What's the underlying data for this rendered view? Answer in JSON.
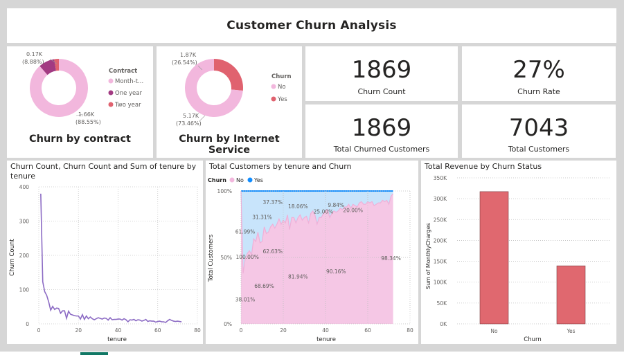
{
  "page_title": "Customer Churn Analysis",
  "contract_card": {
    "title": "Churn by contract",
    "legend_title": "Contract",
    "legend": [
      {
        "label": "Month-t...",
        "color": "#f2b7dd"
      },
      {
        "label": "One year",
        "color": "#a23a82"
      },
      {
        "label": "Two year",
        "color": "#e0626f"
      }
    ],
    "label_small": "0.17K",
    "label_small_pct": "(8.88%)",
    "label_big": "1.66K",
    "label_big_pct": "(88.55%)"
  },
  "internet_card": {
    "title": "Churn by Internet Service",
    "legend_title": "Churn",
    "legend": [
      {
        "label": "No",
        "color": "#f2b7dd"
      },
      {
        "label": "Yes",
        "color": "#e0626f"
      }
    ],
    "label_yes": "1.87K",
    "label_yes_pct": "(26.54%)",
    "label_no": "5.17K",
    "label_no_pct": "(73.46%)"
  },
  "kpis": [
    {
      "value": "1869",
      "label": "Churn Count"
    },
    {
      "value": "27%",
      "label": "Churn Rate"
    },
    {
      "value": "1869",
      "label": "Total Churned Customers"
    },
    {
      "value": "7043",
      "label": "Total Customers"
    }
  ],
  "line_chart": {
    "title_line1": "Churn Count, Churn Count and Sum of tenure by",
    "title_line2": "tenure",
    "ylabel": "Churn Count",
    "xlabel": "tenure",
    "y_ticks": [
      "400",
      "300",
      "200",
      "100",
      "0"
    ],
    "x_ticks": [
      "0",
      "20",
      "40",
      "60",
      "80"
    ]
  },
  "area_chart": {
    "title": "Total Customers by tenure and Churn",
    "legend_title": "Churn",
    "legend": [
      {
        "label": "No",
        "color": "#f2b7dd"
      },
      {
        "label": "Yes",
        "color": "#118dff"
      }
    ],
    "ylabel": "Total Customers",
    "xlabel": "tenure",
    "y_ticks": [
      "100%",
      "50%",
      "0%"
    ],
    "x_ticks": [
      "0",
      "20",
      "40",
      "60",
      "80"
    ],
    "labels": [
      "37.37%",
      "18.06%",
      "9.84%",
      "31.31%",
      "25.00%",
      "20.00%",
      "61.99%",
      "62.63%",
      "100.00%",
      "81.94%",
      "90.16%",
      "98.34%",
      "68.69%",
      "38.01%"
    ]
  },
  "bar_chart": {
    "title": "Total Revenue by Churn Status",
    "ylabel": "Sum of MonthlyCharges",
    "xlabel": "Churn",
    "y_ticks": [
      "350K",
      "300K",
      "250K",
      "200K",
      "150K",
      "100K",
      "50K",
      "0K"
    ],
    "bar_color": "#e0686f"
  },
  "chart_data": [
    {
      "type": "pie",
      "title": "Churn by contract",
      "categories": [
        "Month-to-month",
        "One year",
        "Two year"
      ],
      "values": [
        1655,
        166,
        48
      ],
      "percentages": [
        88.55,
        8.88,
        2.57
      ]
    },
    {
      "type": "pie",
      "title": "Churn by Internet Service",
      "categories": [
        "No",
        "Yes"
      ],
      "values": [
        5174,
        1869
      ],
      "percentages": [
        73.46,
        26.54
      ]
    },
    {
      "type": "line",
      "title": "Churn Count, Churn Count and Sum of tenure by tenure",
      "xlabel": "tenure",
      "ylabel": "Churn Count",
      "xlim": [
        0,
        80
      ],
      "ylim": [
        0,
        400
      ],
      "x": [
        1,
        2,
        3,
        4,
        5,
        6,
        7,
        8,
        9,
        10,
        11,
        12,
        13,
        14,
        15,
        16,
        17,
        18,
        19,
        20,
        21,
        22,
        23,
        24,
        25,
        26,
        27,
        28,
        29,
        30,
        31,
        32,
        33,
        34,
        35,
        36,
        37,
        38,
        39,
        40,
        41,
        42,
        43,
        44,
        45,
        46,
        47,
        48,
        49,
        50,
        51,
        52,
        53,
        54,
        55,
        56,
        57,
        58,
        59,
        60,
        61,
        62,
        63,
        64,
        65,
        66,
        67,
        68,
        69,
        70,
        71,
        72
      ],
      "series": [
        {
          "values": [
            380,
            123,
            94,
            83,
            64,
            40,
            51,
            42,
            46,
            45,
            31,
            38,
            38,
            16,
            37,
            28,
            26,
            24,
            23,
            23,
            14,
            27,
            13,
            23,
            15,
            20,
            15,
            12,
            15,
            18,
            16,
            14,
            17,
            16,
            11,
            18,
            12,
            13,
            13,
            14,
            14,
            11,
            15,
            12,
            6,
            12,
            11,
            13,
            9,
            12,
            11,
            8,
            10,
            13,
            7,
            9,
            8,
            8,
            5,
            7,
            8,
            6,
            6,
            4,
            9,
            13,
            10,
            8,
            7,
            8,
            7,
            6
          ]
        }
      ]
    },
    {
      "type": "area",
      "title": "Total Customers by tenure and Churn",
      "xlabel": "tenure",
      "ylabel": "Total Customers",
      "xlim": [
        0,
        80
      ],
      "ylim": [
        0,
        100
      ],
      "x": [
        0,
        1,
        2,
        3,
        4,
        5,
        6,
        7,
        8,
        9,
        10,
        11,
        12,
        13,
        14,
        15,
        16,
        17,
        18,
        19,
        20,
        21,
        22,
        23,
        24,
        25,
        26,
        27,
        28,
        29,
        30,
        31,
        32,
        33,
        34,
        35,
        36,
        37,
        38,
        39,
        40,
        41,
        42,
        43,
        44,
        45,
        46,
        47,
        48,
        49,
        50,
        51,
        52,
        53,
        54,
        55,
        56,
        57,
        58,
        59,
        60,
        61,
        62,
        63,
        64,
        65,
        66,
        67,
        68,
        69,
        70,
        71,
        72
      ],
      "series": [
        {
          "name": "No",
          "values": [
            100,
            38,
            49,
            53,
            55,
            52,
            64,
            62,
            69,
            61,
            62,
            73,
            68,
            69,
            73,
            75,
            72,
            75,
            79,
            75,
            78,
            76,
            82,
            71,
            80,
            80,
            76,
            80,
            82,
            78,
            80,
            81,
            76,
            83,
            85,
            82,
            75,
            80,
            80,
            83,
            85,
            86,
            80,
            83,
            85,
            84,
            85,
            87,
            86,
            88,
            88,
            90,
            87,
            90,
            89,
            88,
            91,
            92,
            90,
            90,
            92,
            91,
            92,
            89,
            90,
            91,
            91,
            93,
            92,
            93,
            90,
            96,
            98
          ]
        },
        {
          "name": "Yes",
          "values": [
            0,
            62,
            51,
            47,
            45,
            48,
            36,
            38,
            31,
            39,
            38,
            27,
            32,
            31,
            27,
            25,
            28,
            25,
            21,
            25,
            22,
            24,
            18,
            29,
            20,
            20,
            24,
            20,
            18,
            22,
            20,
            19,
            24,
            17,
            15,
            18,
            25,
            20,
            20,
            17,
            15,
            14,
            20,
            17,
            15,
            16,
            15,
            13,
            14,
            12,
            12,
            10,
            13,
            10,
            11,
            12,
            9,
            8,
            10,
            10,
            8,
            9,
            8,
            11,
            10,
            9,
            9,
            7,
            8,
            7,
            10,
            4,
            2
          ]
        }
      ]
    },
    {
      "type": "bar",
      "title": "Total Revenue by Churn Status",
      "xlabel": "Churn",
      "ylabel": "Sum of MonthlyCharges",
      "categories": [
        "No",
        "Yes"
      ],
      "values": [
        316986,
        139131
      ],
      "ylim": [
        0,
        350000
      ]
    }
  ]
}
